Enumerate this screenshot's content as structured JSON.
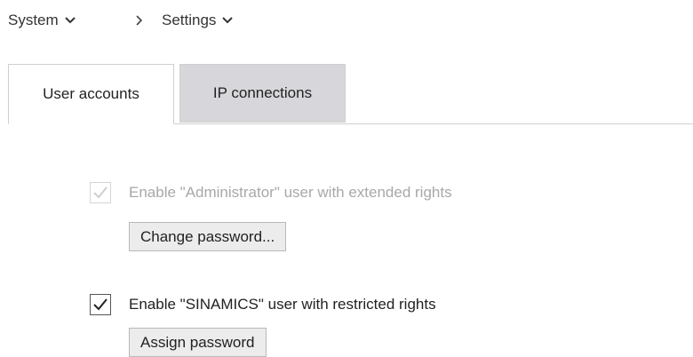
{
  "breadcrumb": {
    "items": [
      {
        "label": "System",
        "icon": "chevron-down-icon"
      },
      {
        "label": "Settings",
        "icon": "chevron-down-icon"
      }
    ],
    "separator_icon": "chevron-right-icon"
  },
  "tabs": [
    {
      "label": "User accounts",
      "active": true
    },
    {
      "label": "IP connections",
      "active": false
    }
  ],
  "options": [
    {
      "label": "Enable \"Administrator\" user with extended rights",
      "checked": true,
      "disabled": true,
      "button_label": "Change password..."
    },
    {
      "label": "Enable \"SINAMICS\" user with restricted rights",
      "checked": true,
      "disabled": false,
      "button_label": "Assign password"
    }
  ],
  "colors": {
    "tab_inactive_bg": "#d7d7db",
    "disabled_text": "#a8a8a8",
    "button_bg": "#ececec"
  }
}
